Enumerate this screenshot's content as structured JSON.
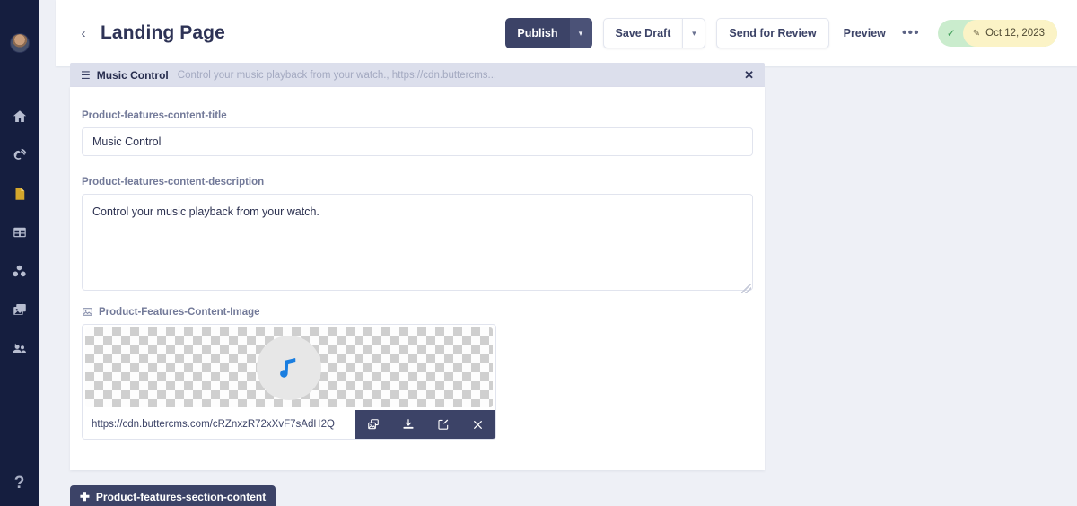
{
  "sidebar": {
    "avatar_name": "user-avatar",
    "items": [
      {
        "icon": "home-icon",
        "name": "home",
        "active": false
      },
      {
        "icon": "blog-icon",
        "name": "blog",
        "active": false
      },
      {
        "icon": "pages-icon",
        "name": "pages",
        "active": true
      },
      {
        "icon": "collections-icon",
        "name": "collections",
        "active": false
      },
      {
        "icon": "components-icon",
        "name": "components",
        "active": false
      },
      {
        "icon": "media-icon",
        "name": "media",
        "active": false
      },
      {
        "icon": "users-icon",
        "name": "users",
        "active": false
      }
    ],
    "help_label": "?"
  },
  "header": {
    "back_label": "‹",
    "title": "Landing Page",
    "publish_label": "Publish",
    "publish_caret": "▾",
    "save_draft_label": "Save Draft",
    "save_draft_caret": "▾",
    "send_for_review_label": "Send for Review",
    "preview_label": "Preview",
    "more_label": "•••",
    "status_check": "✓",
    "status_pencil": "✎",
    "status_date": "Oct 12, 2023",
    "status_color_published": "#caeccd",
    "status_color_scheduled": "#fbf3c6"
  },
  "section_strip": {
    "grip_icon": "drag-handle-icon",
    "title": "Music Control",
    "subtitle": "Control your music playback from your watch., https://cdn.buttercms...",
    "close_label": "✕"
  },
  "fields": {
    "title": {
      "label": "Product-features-content-title",
      "value": "Music Control",
      "placeholder": ""
    },
    "description": {
      "label": "Product-features-content-description",
      "value": "Control your music playback from your watch.",
      "placeholder": ""
    },
    "image": {
      "label": "Product-Features-Content-Image",
      "url": "https://cdn.buttercms.com/cRZnxzR72xXvF7sAdH2Q",
      "note_color": "#1a7ee0",
      "tools": [
        {
          "name": "duplicate-image-icon",
          "label": "Copy"
        },
        {
          "name": "download-icon",
          "label": "Download"
        },
        {
          "name": "edit-icon",
          "label": "Edit"
        },
        {
          "name": "remove-icon",
          "label": "Remove"
        }
      ]
    }
  },
  "add_section": {
    "plus": "✚",
    "label": "Product-features-section-content"
  }
}
